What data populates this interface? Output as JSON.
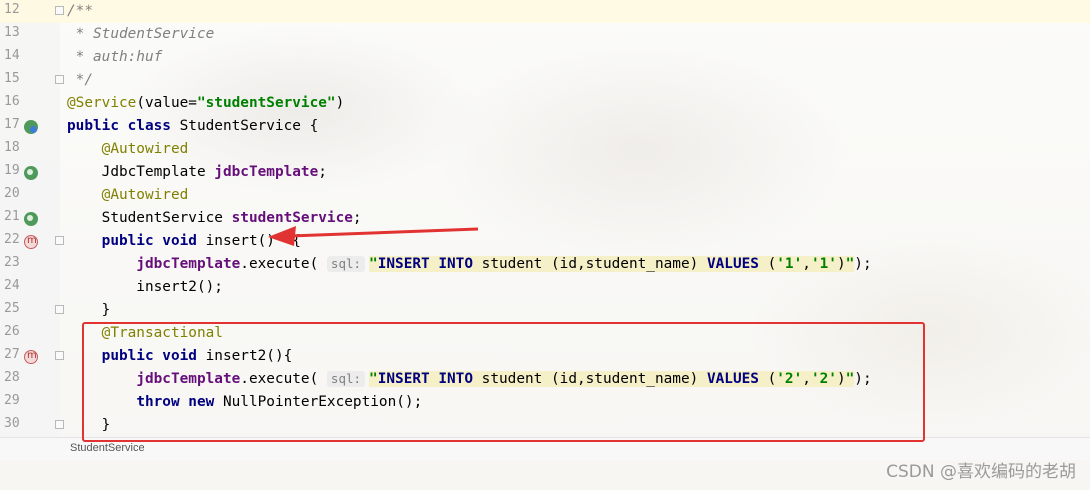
{
  "editor": {
    "lines": [
      {
        "n": "12",
        "code": [
          {
            "t": "/**",
            "c": "cm"
          }
        ]
      },
      {
        "n": "13",
        "code": [
          {
            "t": " * StudentService",
            "c": "cm"
          }
        ]
      },
      {
        "n": "14",
        "code": [
          {
            "t": " * auth:huf",
            "c": "cm"
          }
        ]
      },
      {
        "n": "15",
        "code": [
          {
            "t": " */",
            "c": "cm"
          }
        ]
      },
      {
        "n": "16",
        "code": [
          {
            "t": "@Service",
            "c": "an"
          },
          {
            "t": "(value="
          },
          {
            "t": "\"studentService\"",
            "c": "str"
          },
          {
            "t": ")"
          }
        ]
      },
      {
        "n": "17",
        "code": [
          {
            "t": "public class",
            "c": "k"
          },
          {
            "t": " StudentService {"
          }
        ]
      },
      {
        "n": "18",
        "code": [
          {
            "t": "    "
          },
          {
            "t": "@Autowired",
            "c": "an"
          }
        ]
      },
      {
        "n": "19",
        "code": [
          {
            "t": "    JdbcTemplate "
          },
          {
            "t": "jdbcTemplate",
            "c": "fld"
          },
          {
            "t": ";"
          }
        ]
      },
      {
        "n": "20",
        "code": [
          {
            "t": "    "
          },
          {
            "t": "@Autowired",
            "c": "an"
          }
        ]
      },
      {
        "n": "21",
        "code": [
          {
            "t": "    StudentService "
          },
          {
            "t": "studentService",
            "c": "fld"
          },
          {
            "t": ";"
          }
        ]
      },
      {
        "n": "22",
        "code": [
          {
            "t": "    "
          },
          {
            "t": "public void",
            "c": "k"
          },
          {
            "t": " insert()  {"
          }
        ]
      },
      {
        "n": "23",
        "code": [
          {
            "t": "        "
          },
          {
            "t": "jdbcTemplate",
            "c": "fld"
          },
          {
            "t": ".execute( "
          },
          {
            "t": "sql:",
            "c": "hint"
          },
          {
            "t": "\"",
            "c": "str"
          },
          {
            "t": "INSERT INTO",
            "c": "sqlkw"
          },
          {
            "t": " student (id,student_name) ",
            "c": "sqlid"
          },
          {
            "t": "VALUES",
            "c": "sqlkw"
          },
          {
            "t": " (",
            "c": "sqlid"
          },
          {
            "t": "'1'",
            "c": "str"
          },
          {
            "t": ",",
            "c": "sqlid"
          },
          {
            "t": "'1'",
            "c": "str"
          },
          {
            "t": ")",
            "c": "sqlid"
          },
          {
            "t": "\"",
            "c": "str"
          },
          {
            "t": ");"
          }
        ]
      },
      {
        "n": "24",
        "code": [
          {
            "t": "        insert2();"
          }
        ]
      },
      {
        "n": "25",
        "code": [
          {
            "t": "    }"
          }
        ]
      },
      {
        "n": "26",
        "code": [
          {
            "t": "    "
          },
          {
            "t": "@Transactional",
            "c": "an"
          }
        ]
      },
      {
        "n": "27",
        "code": [
          {
            "t": "    "
          },
          {
            "t": "public void",
            "c": "k"
          },
          {
            "t": " insert2(){"
          }
        ]
      },
      {
        "n": "28",
        "code": [
          {
            "t": "        "
          },
          {
            "t": "jdbcTemplate",
            "c": "fld"
          },
          {
            "t": ".execute( "
          },
          {
            "t": "sql:",
            "c": "hint"
          },
          {
            "t": "\"",
            "c": "str"
          },
          {
            "t": "INSERT INTO",
            "c": "sqlkw"
          },
          {
            "t": " student (id,student_name) ",
            "c": "sqlid"
          },
          {
            "t": "VALUES",
            "c": "sqlkw"
          },
          {
            "t": " (",
            "c": "sqlid"
          },
          {
            "t": "'2'",
            "c": "str"
          },
          {
            "t": ",",
            "c": "sqlid"
          },
          {
            "t": "'2'",
            "c": "str"
          },
          {
            "t": ")",
            "c": "sqlid"
          },
          {
            "t": "\"",
            "c": "str"
          },
          {
            "t": ");"
          }
        ]
      },
      {
        "n": "29",
        "code": [
          {
            "t": "        "
          },
          {
            "t": "throw new",
            "c": "k"
          },
          {
            "t": " NullPointerException();"
          }
        ]
      },
      {
        "n": "30",
        "code": [
          {
            "t": "    }"
          }
        ]
      }
    ],
    "gutter_icons": {
      "17": "bean-class-icon",
      "19": "bean-icon",
      "21": "bean-icon",
      "22": "method-icon",
      "27": "method-icon"
    },
    "fold_lines": [
      "12",
      "15",
      "22",
      "25",
      "27",
      "30"
    ]
  },
  "status": {
    "breadcrumb": "StudentService"
  },
  "watermark": "CSDN @喜欢编码的老胡",
  "colors": {
    "annotation_box": "#e23333",
    "arrow": "#e23333"
  }
}
